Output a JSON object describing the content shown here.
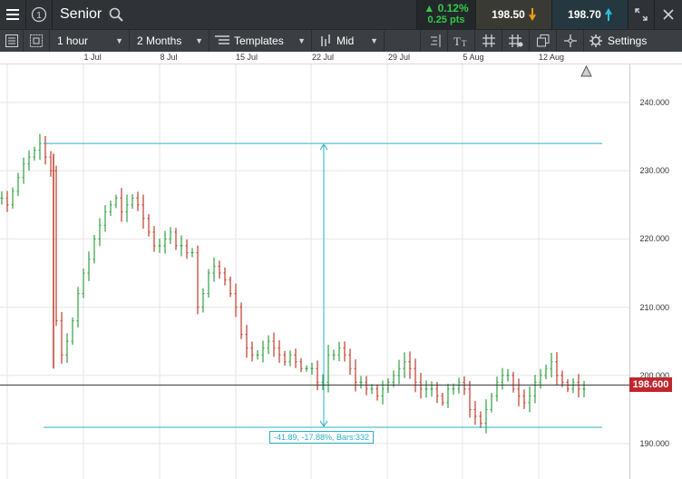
{
  "header": {
    "instrument": "Senior",
    "change_pct": "▲ 0.12%",
    "change_pts": "0.25 pts",
    "sell_price": "198.50",
    "buy_price": "198.70",
    "colors": {
      "up": "#33c94a",
      "sell_arrow": "#f39c12",
      "buy_arrow": "#29c3e0"
    }
  },
  "toolbar": {
    "interval": "1 hour",
    "range": "2 Months",
    "templates": "Templates",
    "price_type": "Mid",
    "settings": "Settings"
  },
  "date_axis": [
    "1 Jul",
    "8 Jul",
    "15 Jul",
    "22 Jul",
    "29 Jul",
    "5 Aug",
    "12 Aug"
  ],
  "price_axis": [
    "240.000",
    "230.000",
    "220.000",
    "210.000",
    "200.000",
    "190.000"
  ],
  "last_price": "198.600",
  "measure_label": "-41.89, -17.88%, Bars:332",
  "chart_data": {
    "type": "ohlc",
    "y_range": [
      186,
      245
    ],
    "last_price": 198.6,
    "measure": {
      "high": 234,
      "low": 192.4,
      "change": -41.89,
      "change_pct": -17.88,
      "bars": 332
    },
    "colors": {
      "up": "#2ea043",
      "down": "#c0392b",
      "measure": "#2ab0c4",
      "last_price_line": "#333333"
    },
    "close_path": [
      226,
      225,
      227,
      229,
      231,
      232,
      233,
      234,
      232,
      230,
      208,
      203,
      205,
      208,
      212,
      215,
      217,
      220,
      222,
      224,
      225,
      226,
      224,
      225,
      226,
      225,
      223,
      221,
      219,
      219,
      220,
      221,
      219,
      219,
      218,
      218,
      210,
      212,
      215,
      216,
      215,
      214,
      212,
      210,
      206,
      204,
      203,
      203,
      204,
      205,
      204,
      203,
      202,
      203,
      202,
      201,
      201,
      201,
      199,
      199,
      203,
      203,
      204,
      203,
      201,
      199,
      199,
      198,
      198,
      197,
      198,
      199,
      200,
      201,
      202,
      201,
      199,
      198,
      198,
      198,
      197,
      196,
      198,
      198,
      199,
      198,
      195,
      194,
      193,
      195,
      197,
      199,
      200,
      200,
      198,
      197,
      196,
      197,
      199,
      200,
      201,
      202,
      200,
      199,
      198,
      199,
      198,
      198
    ]
  }
}
